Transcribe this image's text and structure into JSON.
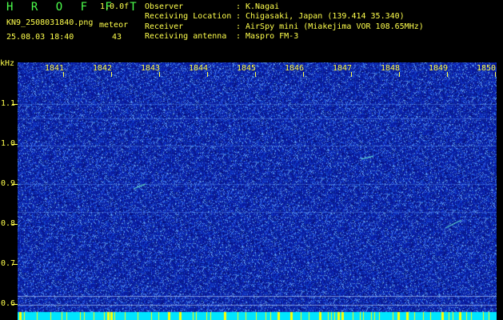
{
  "header": {
    "app_title": "H R O F F T",
    "version": "1.0.0f",
    "file_name": "KN9_2508031840.png",
    "meteor_label": "meteor",
    "datetime": "25.08.03 18:40",
    "meteor_count": "43"
  },
  "station_info": [
    {
      "label": "Observer",
      "value": "K.Nagai"
    },
    {
      "label": "Receiving Location",
      "value": "Chigasaki, Japan (139.414 35.340)"
    },
    {
      "label": "Receiver",
      "value": "AirSpy mini (Miakejima VOR 108.65MHz)"
    },
    {
      "label": "Receiving antenna",
      "value": "Maspro FM-3"
    }
  ],
  "separator": ":",
  "spectrogram": {
    "unit_label": "kHz",
    "freq_ticks": [
      "1.1",
      "1.0",
      "0.9",
      "0.8",
      "0.7",
      "0.6"
    ],
    "time_ticks": [
      "1841",
      "1842",
      "1843",
      "1844",
      "1845",
      "1846",
      "1847",
      "1848",
      "1849",
      "1850"
    ],
    "freq_range_khz": [
      0.58,
      1.19
    ],
    "time_range": [
      "18:40",
      "18:50"
    ],
    "colors": {
      "background": "#0a1a9c",
      "noise_speck": "#5aa0ff",
      "signal": "#6fffd6",
      "baseline": "#00e5ff",
      "marker": "#ffff00",
      "label": "#ffff4c"
    }
  }
}
